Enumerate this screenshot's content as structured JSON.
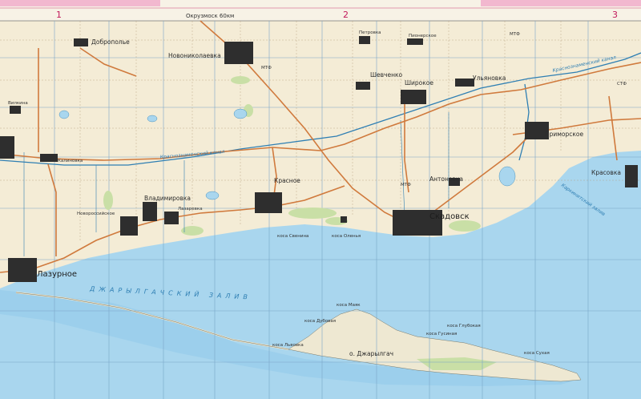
{
  "header": {
    "grid_numbers": [
      "1",
      "2",
      "3"
    ],
    "top_note": "Окрузмоск 60км"
  },
  "water": {
    "bay_main": "ДЖАРЫЛГАЧСКИЙ ЗАЛИВ",
    "bay_right": "Каркинитский залив",
    "canal_1": "Краснознаменский канал",
    "canal_2": "Краснознаменский канал"
  },
  "places": {
    "dobropolye": "Доброполье",
    "novonikolaevka": "Новониколаевка",
    "petrovka": "Петровка",
    "shevchenko": "Шевченко",
    "shirokoe": "Широкое",
    "ulyanovka": "Ульяновка",
    "pridneprovskoe": "Пионерское",
    "kalinovka": "Калиновка",
    "gribovka": "Вилкина",
    "krasnoye": "Красное",
    "vladimirovka": "Владимировка",
    "novoross": "Новороссийское",
    "lazurnoye": "Лазурное",
    "skadovsk": "Скадовск",
    "antonovka": "Антоновка",
    "primorskoe": "Приморское",
    "krasovka": "Красовка",
    "dzharylgach": "о. Джарылгач",
    "lazarevka_small": "Лазаревка",
    "kosa_svenskaya": "коса Свенина",
    "kosa_oshenya": "коса Оленья",
    "kosa_lvovskaya": "коса Львовка",
    "kosa_dubovaya": "коса Дубовая",
    "kosa_mayak": "коса Маяк",
    "kosa_glubokaya": "коса Глубокая",
    "kosa_sukh": "коса Сухая",
    "kosa_gusy": "коса Гусиная",
    "mts_1": "МТФ",
    "mts_2": "МТФ",
    "mts_3": "МТФ",
    "mts_4": "СТФ"
  },
  "colors": {
    "land": "#f4ecd6",
    "sea": "#a9d6ee",
    "sea_deep": "#8fc8e8",
    "road": "#d07a3d",
    "settlement": "#2e2e2e",
    "canal": "#2f7fb3",
    "grid": "#7aa6c8",
    "green": "#c9dfa6",
    "header_pink": "#f2b8cf"
  }
}
